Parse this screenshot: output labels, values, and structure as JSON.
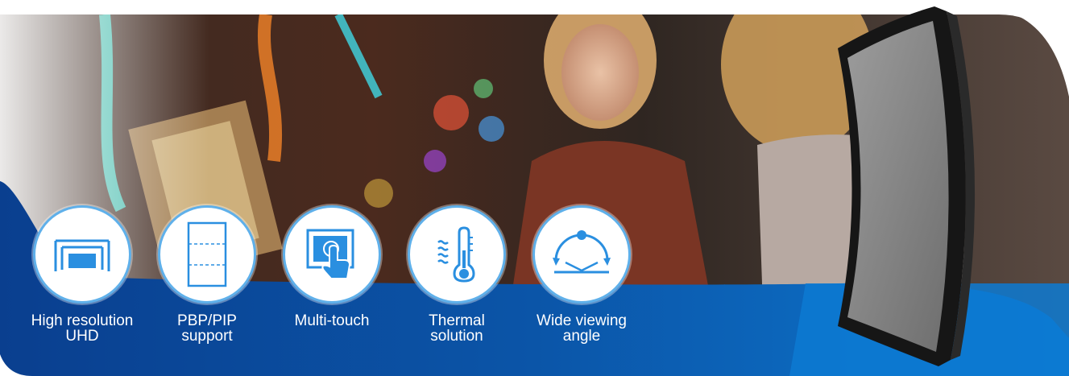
{
  "colors": {
    "brand_blue": "#0d5fb3",
    "deep_blue": "#0a3f8f",
    "icon_blue": "#2a8fe0",
    "circle_border": "#5fb0ea"
  },
  "features": [
    {
      "label": "High resolution\nUHD",
      "icon": "monitor-resolution-icon"
    },
    {
      "label": "PBP/PIP\nsupport",
      "icon": "split-screen-icon"
    },
    {
      "label": "Multi-touch",
      "icon": "touch-screen-icon"
    },
    {
      "label": "Thermal\nsolution",
      "icon": "thermometer-icon"
    },
    {
      "label": "Wide viewing\nangle",
      "icon": "viewing-angle-icon"
    }
  ]
}
